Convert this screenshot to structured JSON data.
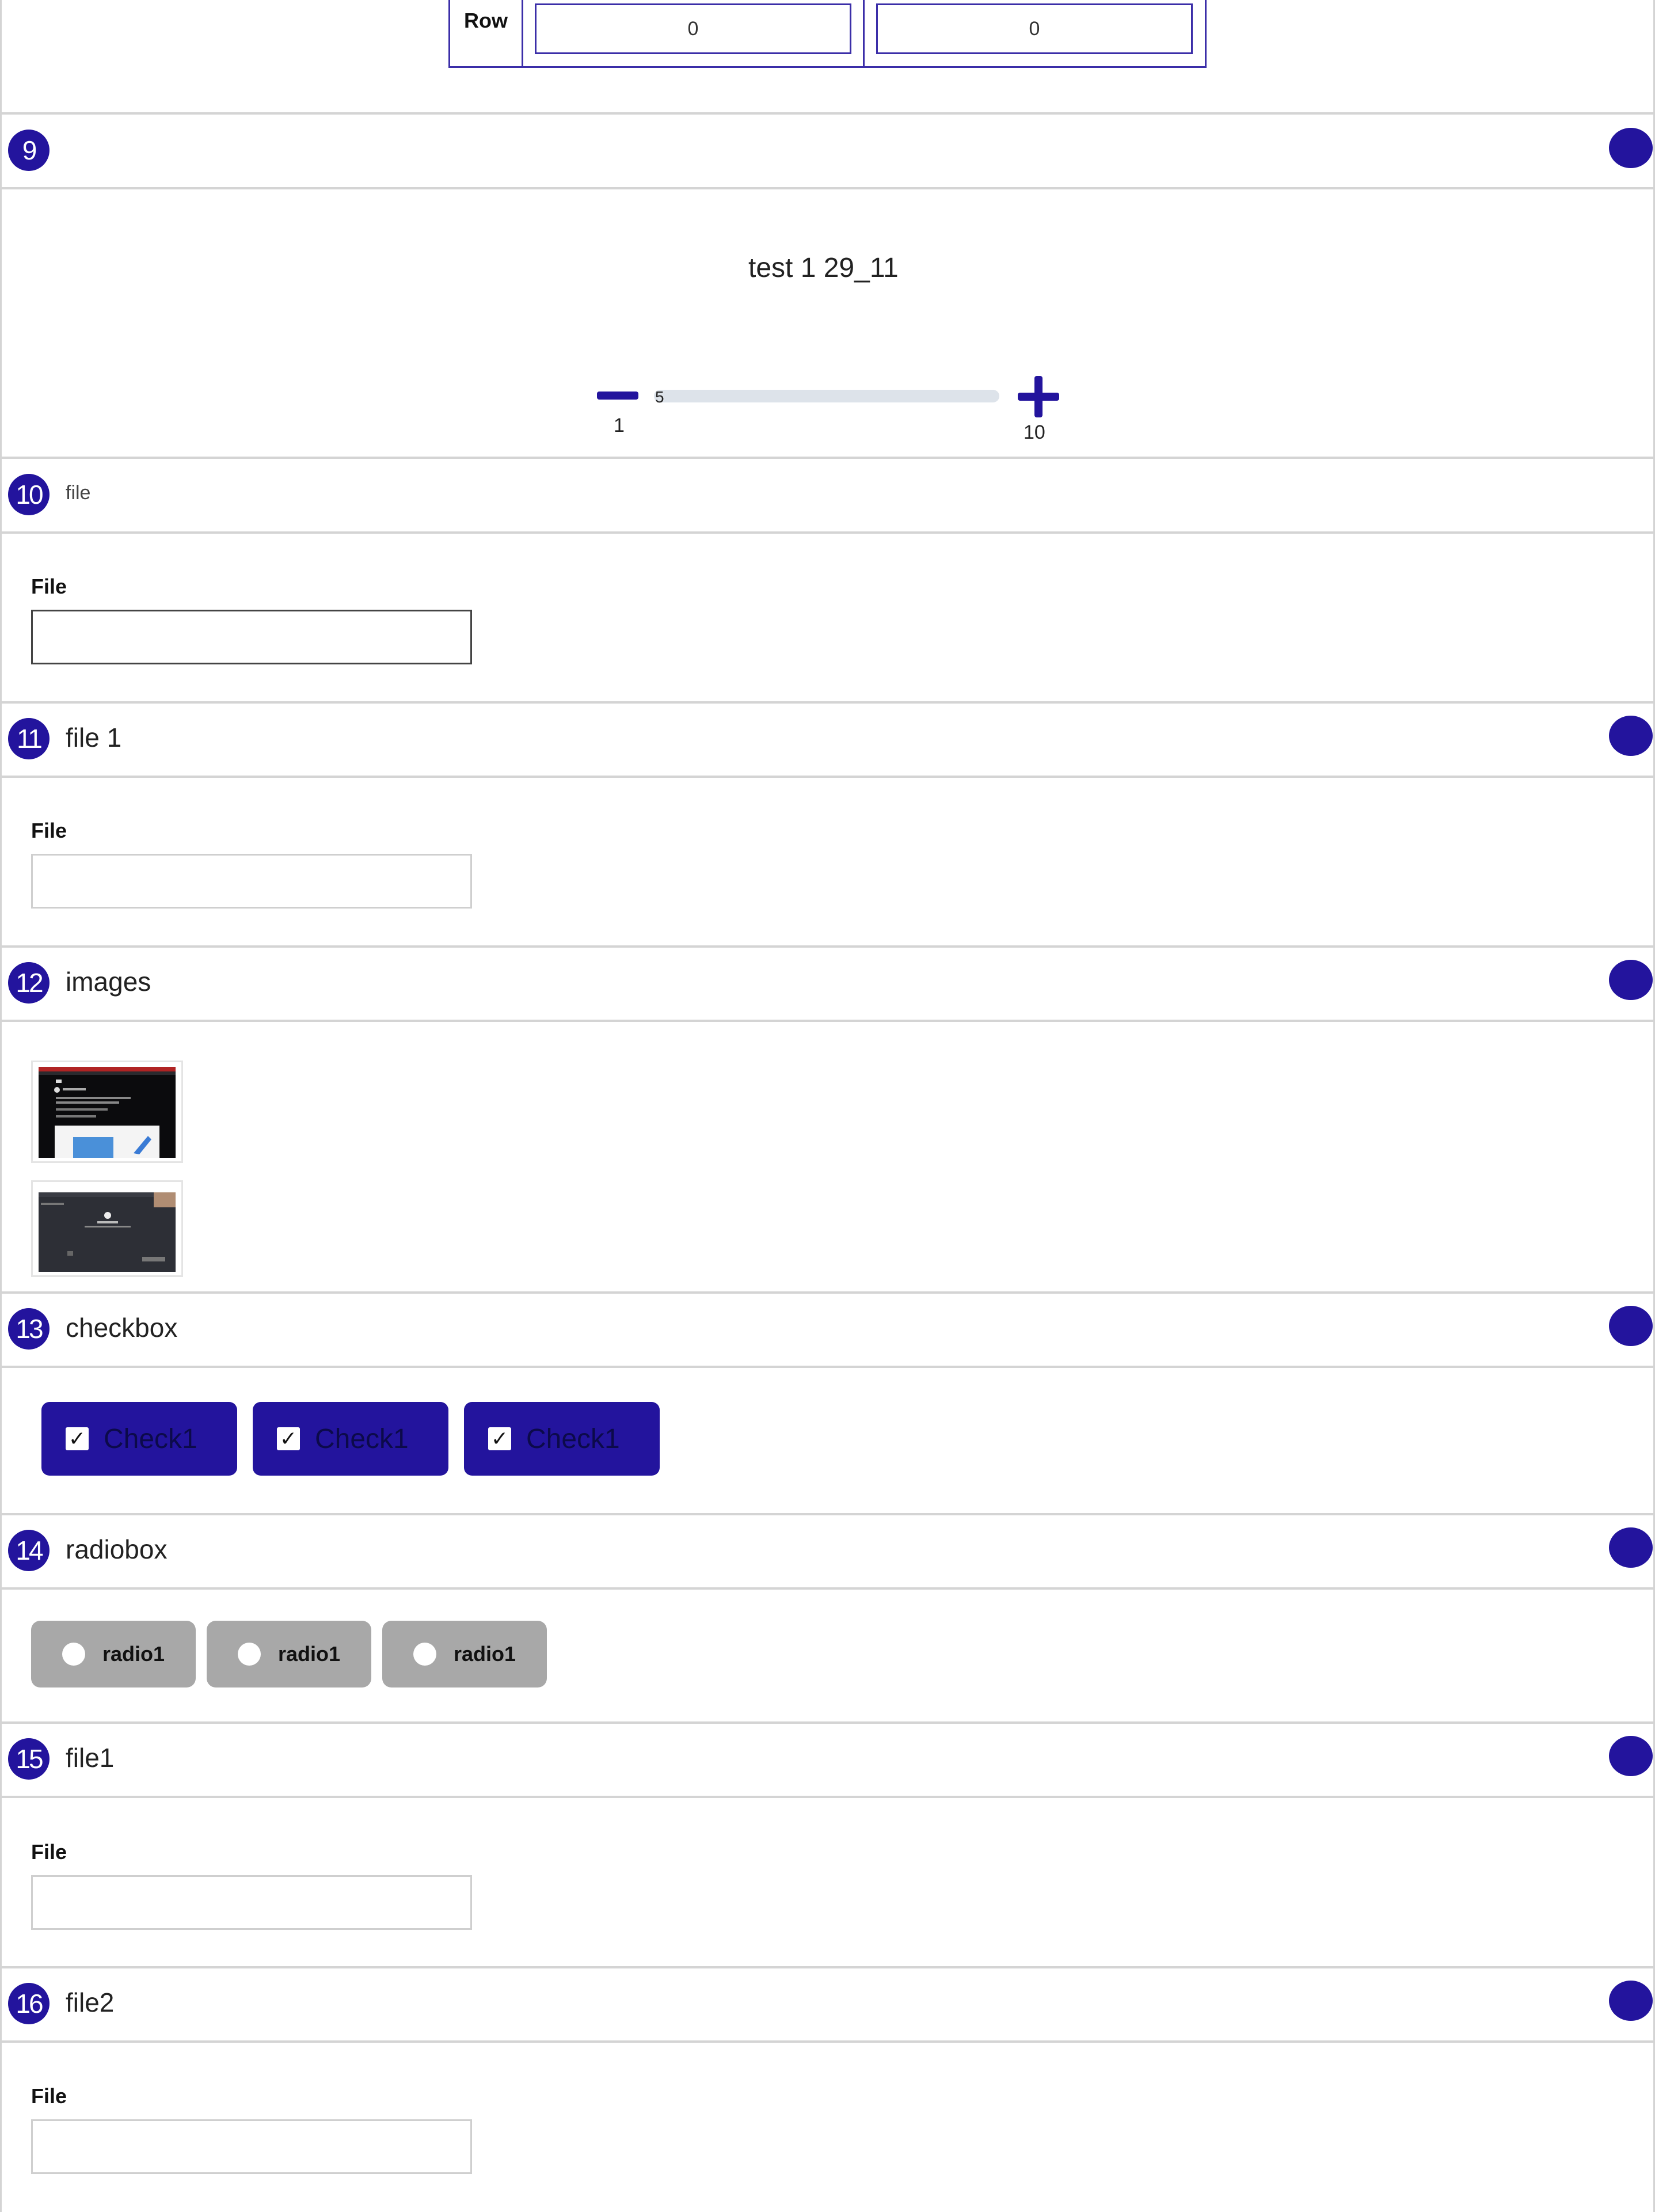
{
  "top_table": {
    "row_label": "Row",
    "values": [
      "0",
      "0"
    ]
  },
  "sections": {
    "s9": {
      "number": "9",
      "title": ""
    },
    "s10": {
      "number": "10",
      "title": "file",
      "field_label": "File"
    },
    "s11": {
      "number": "11",
      "title": "file 1",
      "field_label": "File"
    },
    "s12": {
      "number": "12",
      "title": "images"
    },
    "s13": {
      "number": "13",
      "title": "checkbox"
    },
    "s14": {
      "number": "14",
      "title": "radiobox"
    },
    "s15": {
      "number": "15",
      "title": "file1",
      "field_label": "File"
    },
    "s16": {
      "number": "16",
      "title": "file2",
      "field_label": "File"
    }
  },
  "slider": {
    "title": "test 1 29_11",
    "min_label": "1",
    "max_label": "10",
    "value": "5"
  },
  "checkboxes": [
    {
      "label": "Check1",
      "checked": true
    },
    {
      "label": "Check1",
      "checked": true
    },
    {
      "label": "Check1",
      "checked": true
    }
  ],
  "radios": [
    {
      "label": "radio1"
    },
    {
      "label": "radio1"
    },
    {
      "label": "radio1"
    }
  ],
  "icons": {
    "checkmark": "✓"
  },
  "colors": {
    "accent": "#23149d",
    "radio_bg": "#a8a8a8",
    "track": "#dde3ea"
  }
}
